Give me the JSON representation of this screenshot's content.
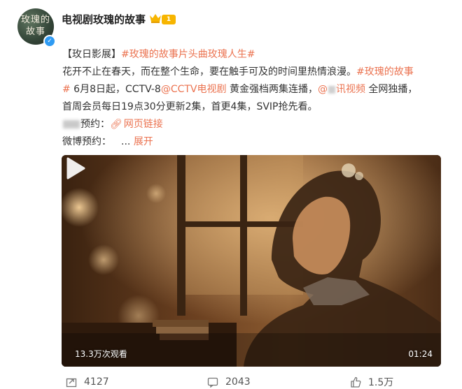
{
  "account": {
    "name": "电视剧玫瑰的故事",
    "avatar_text_line1": "玫瑰的",
    "avatar_text_line2": "故事",
    "vip_level": "1"
  },
  "post": {
    "line1": {
      "prefix": "【玫日影展】",
      "hashtag": "#玫瑰的故事片头曲玫瑰人生#"
    },
    "line2": {
      "text": "花开不止在春天，而在整个生命，要在触手可及的时间里热情浪漫。",
      "hashtag_start": "#玫瑰的故事"
    },
    "line3": {
      "hashtag_end": "#",
      "text_a": " 6月8日起，CCTV-8",
      "mention_cctv": "@CCTV电视剧",
      "text_b": " 黄金强档两集连播，",
      "mention_video_a": "@",
      "mention_video_b": "讯视频",
      "text_c": " 全网独播，"
    },
    "line4": {
      "text": "首周会员每日19点30分更新2集，首更4集，SVIP抢先看。"
    },
    "line5": {
      "label_suffix": "预约：",
      "link": "网页链接"
    },
    "line6": {
      "label": "微博预约：",
      "ellipsis": "... ",
      "expand": "展开"
    }
  },
  "video": {
    "view_count": "13.3万次观看",
    "duration": "01:24"
  },
  "actions": {
    "repost_count": "4127",
    "comment_count": "2043",
    "like_count": "1.5万"
  },
  "colors": {
    "link": "#eb7350",
    "text": "#333333",
    "verified": "#2f9bf3",
    "vip": "#f7b500"
  }
}
